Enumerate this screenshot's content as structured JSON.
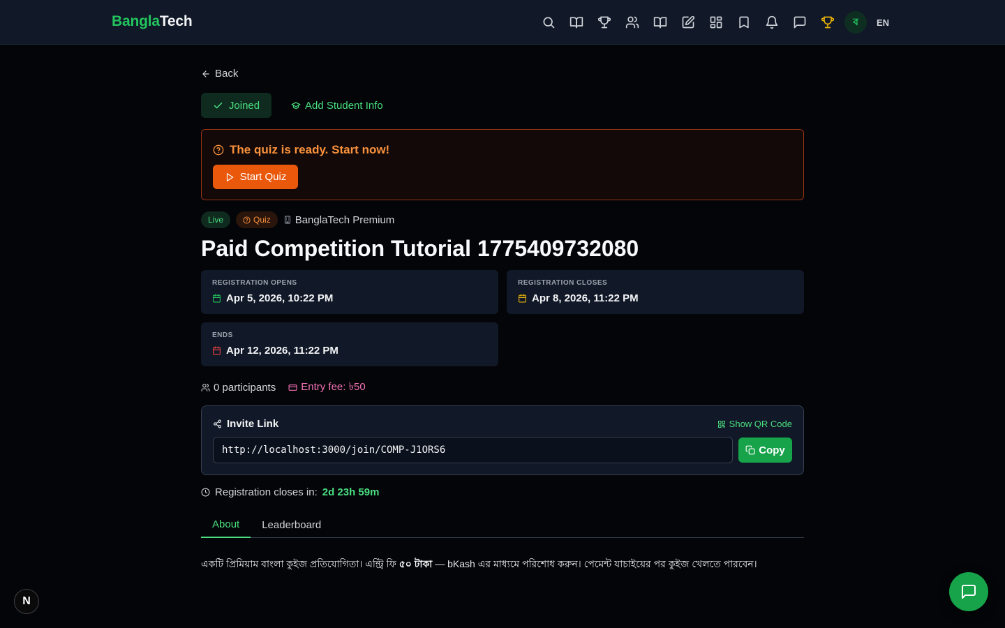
{
  "header": {
    "brand_part1": "Bangla",
    "brand_part2": "Tech",
    "nav_icons": [
      "search-icon",
      "book-icon",
      "trophy-icon",
      "users-icon",
      "book-open-icon",
      "edit-icon",
      "grid-icon",
      "bookmark-icon",
      "bell-icon",
      "message-icon",
      "trophy-gold-icon"
    ],
    "avatar_letter": "ব",
    "language": "EN"
  },
  "page": {
    "back_label": "Back",
    "joined_label": "Joined",
    "student_info_label": "Add Student Info",
    "alert_text": "The quiz is ready. Start now!",
    "start_quiz_label": "Start Quiz",
    "tag_live": "Live",
    "tag_quiz": "Quiz",
    "organizer": "BanglaTech Premium",
    "title": "Paid Competition Tutorial 1775409732080",
    "registration_opens_label": "REGISTRATION OPENS",
    "registration_opens_value": "Apr 5, 2026, 10:22 PM",
    "registration_closes_label": "REGISTRATION CLOSES",
    "registration_closes_value": "Apr 8, 2026, 11:22 PM",
    "ends_label": "ENDS",
    "ends_value": "Apr 12, 2026, 11:22 PM",
    "participants": "0 participants",
    "entry_fee": "Entry fee: ৳50",
    "invite_title": "Invite Link",
    "show_qr_label": "Show QR Code",
    "invite_url": "http://localhost:3000/join/COMP-J1ORS6",
    "copy_label": "Copy",
    "closes_in_label": "Registration closes in:",
    "closes_in_value": "2d 23h 59m",
    "tab_about": "About",
    "tab_leaderboard": "Leaderboard",
    "description_part1": "একটি প্রিমিয়াম বাংলা কুইজ প্রতিযোগিতা। এন্ট্রি ফি ",
    "description_bold": "৫০ টাকা",
    "description_part2": " — bKash এর মাধ্যমে পরিশোধ করুন। পেমেন্ট যাচাইয়ের পর কুইজ খেলতে পারবেন।"
  },
  "colors": {
    "accent_green": "#22c55e",
    "alert_orange": "#ea580c",
    "fee_pink": "#f472b6",
    "gold": "#eab308"
  },
  "floating": {
    "nextjs_badge": "N"
  }
}
